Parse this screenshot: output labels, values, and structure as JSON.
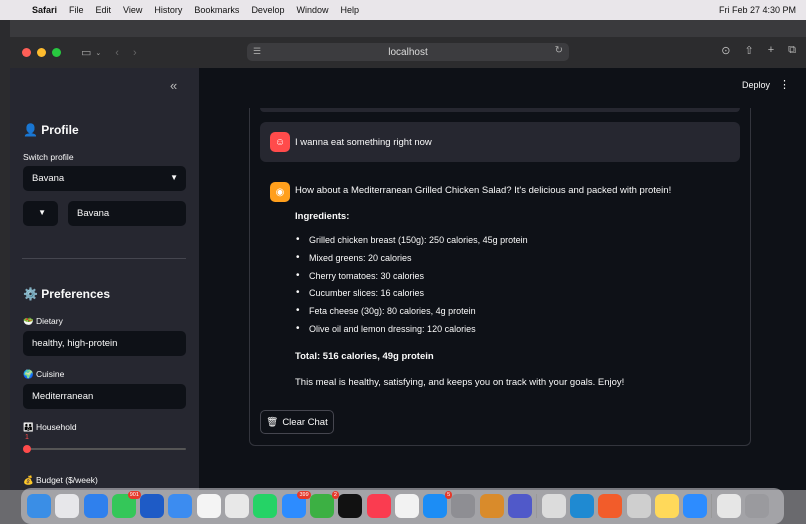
{
  "menubar": {
    "app": "Safari",
    "items": [
      "File",
      "Edit",
      "View",
      "History",
      "Bookmarks",
      "Develop",
      "Window",
      "Help"
    ],
    "datetime": "Fri Feb 27  4:30 PM"
  },
  "browser": {
    "url": "localhost"
  },
  "sidebar": {
    "profile_heading": "👤 Profile",
    "switch_profile_label": "Switch profile",
    "switch_profile_value": "Bavana",
    "name_value": "Bavana",
    "preferences_heading": "⚙️ Preferences",
    "dietary_label": "🥗 Dietary",
    "dietary_value": "healthy, high-protein",
    "cuisine_label": "🌍 Cuisine",
    "cuisine_value": "Mediterranean",
    "household_label": "👪 Household",
    "household_value": "1",
    "budget_label": "💰 Budget ($/week)"
  },
  "header": {
    "deploy_label": "Deploy"
  },
  "chat": {
    "user_message": "I wanna eat something right now",
    "assistant_intro": "How about a Mediterranean Grilled Chicken Salad? It's delicious and packed with protein!",
    "ingredients_heading": "Ingredients:",
    "ingredients": [
      "Grilled chicken breast (150g): 250 calories, 45g protein",
      "Mixed greens: 20 calories",
      "Cherry tomatoes: 30 calories",
      "Cucumber slices: 16 calories",
      "Feta cheese (30g): 80 calories, 4g protein",
      "Olive oil and lemon dressing: 120 calories"
    ],
    "total": "Total: 516 calories, 49g protein",
    "closing": "This meal is healthy, satisfying, and keeps you on track with your goals. Enjoy!",
    "clear_button": "Clear Chat"
  },
  "dock": {
    "badges": [
      "901",
      "399",
      "2",
      "5"
    ]
  },
  "colors": {
    "accent": "#ff4b4b",
    "sidebar_bg": "#262730",
    "main_bg": "#0e1117"
  }
}
